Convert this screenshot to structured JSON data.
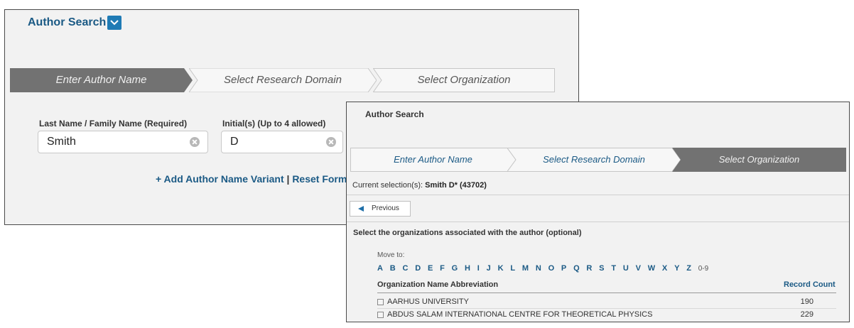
{
  "back_panel": {
    "title": "Author Search",
    "steps": [
      {
        "label": "Enter Author Name",
        "active": true
      },
      {
        "label": "Select Research Domain",
        "active": false
      },
      {
        "label": "Select Organization",
        "active": false
      }
    ],
    "last_name_label": "Last Name / Family Name  (Required)",
    "last_name_value": "Smith",
    "initials_label": "Initial(s)  (Up to 4 allowed)",
    "initials_value": "D",
    "add_variant_link": "+ Add Author Name Variant",
    "separator": "|",
    "reset_link": "Reset Form"
  },
  "front_panel": {
    "title": "Author Search",
    "steps": [
      {
        "label": "Enter Author Name",
        "active": false
      },
      {
        "label": "Select Research Domain",
        "active": false
      },
      {
        "label": "Select Organization",
        "active": true
      }
    ],
    "current_selection_label": "Current selection(s):",
    "current_selection_value": "Smith D* (43702)",
    "previous_button": "Previous",
    "orgs_heading": "Select the organizations associated with the author (optional)",
    "move_to_label": "Move to:",
    "letters": [
      "A",
      "B",
      "C",
      "D",
      "E",
      "F",
      "G",
      "H",
      "I",
      "J",
      "K",
      "L",
      "M",
      "N",
      "O",
      "P",
      "Q",
      "R",
      "S",
      "T",
      "U",
      "V",
      "W",
      "X",
      "Y",
      "Z"
    ],
    "numbers_link": "0-9",
    "table": {
      "col_name": "Organization Name Abbreviation",
      "col_count": "Record Count",
      "rows": [
        {
          "name": "AARHUS UNIVERSITY",
          "count": "190"
        },
        {
          "name": "ABDUS SALAM INTERNATIONAL CENTRE FOR THEORETICAL PHYSICS",
          "count": "229"
        }
      ]
    }
  },
  "colors": {
    "active_step": "#727272",
    "inactive_step": "#f7f7f7",
    "link": "#1b5a85",
    "accent": "#1f7bb5"
  }
}
